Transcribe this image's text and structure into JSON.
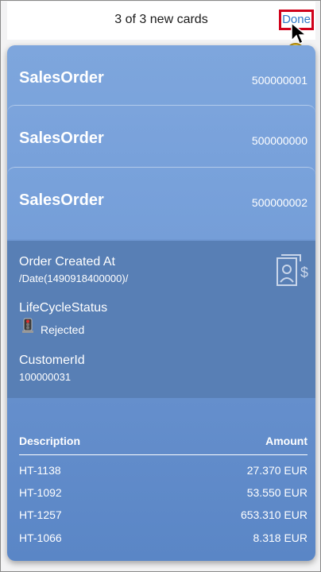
{
  "header": {
    "title": "3 of 3 new cards",
    "done_label": "Done"
  },
  "annotation": {
    "step": "1"
  },
  "cards": [
    {
      "title": "SalesOrder",
      "number": "500000001"
    },
    {
      "title": "SalesOrder",
      "number": "500000000"
    },
    {
      "title": "SalesOrder",
      "number": "500000002"
    }
  ],
  "details": {
    "created_label": "Order Created At",
    "created_value": "/Date(1490918400000)/",
    "status_label": "LifeCycleStatus",
    "status_value": "Rejected",
    "customer_label": "CustomerId",
    "customer_value": "100000031",
    "icon": "price-document-icon"
  },
  "table": {
    "headers": {
      "description": "Description",
      "amount": "Amount"
    },
    "rows": [
      {
        "description": "HT-1138",
        "amount": "27.370 EUR"
      },
      {
        "description": "HT-1092",
        "amount": "53.550 EUR"
      },
      {
        "description": "HT-1257",
        "amount": "653.310 EUR"
      },
      {
        "description": "HT-1066",
        "amount": "8.318 EUR"
      }
    ]
  },
  "colors": {
    "accent": "#2f78c8",
    "highlight": "#d0021b",
    "card": "#6f97d2"
  }
}
